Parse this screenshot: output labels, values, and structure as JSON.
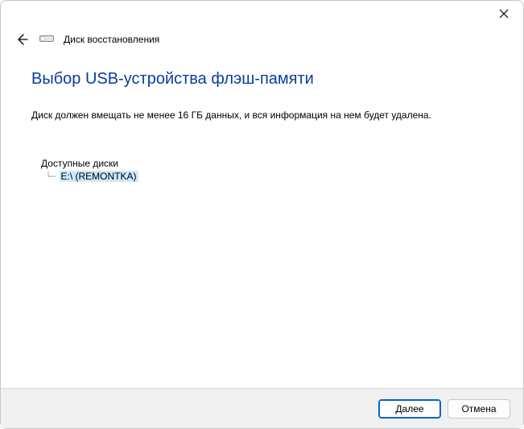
{
  "window": {
    "title": "Диск восстановления"
  },
  "page": {
    "heading": "Выбор USB-устройства флэш-памяти",
    "description": "Диск должен вмещать не менее 16 ГБ данных, и вся информация на нем будет удалена."
  },
  "tree": {
    "root_label": "Доступные диски",
    "items": [
      {
        "label": "E:\\ (REMONTKA)",
        "selected": true
      }
    ]
  },
  "footer": {
    "next_label": "Далее",
    "cancel_label": "Отмена"
  }
}
